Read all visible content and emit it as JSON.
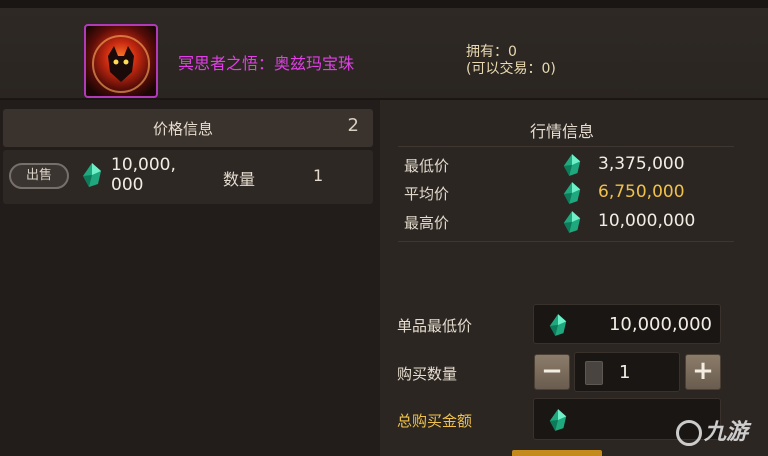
{
  "item": {
    "name": "冥思者之悟：奥兹玛宝珠",
    "owned_line": "拥有：0",
    "tradable_line": "(可以交易：0)",
    "icon": "demon-orb-icon"
  },
  "price_info": {
    "title": "价格信息",
    "count": "2",
    "listings": [
      {
        "badge": "出售",
        "price": "10,000,000",
        "qty_label": "数量",
        "qty": "1",
        "currency_icon": "gem-icon"
      }
    ]
  },
  "market": {
    "title": "行情信息",
    "rows": [
      {
        "label": "最低价",
        "value": "3,375,000"
      },
      {
        "label": "平均价",
        "value": "6,750,000"
      },
      {
        "label": "最高价",
        "value": "10,000,000"
      }
    ]
  },
  "purchase": {
    "unit_price_label": "单品最低价",
    "unit_price_value": "10,000,000",
    "quantity_label": "购买数量",
    "quantity_value": "1",
    "minus_label": "−",
    "plus_label": "+",
    "total_label": "总购买金额",
    "total_value": ""
  },
  "watermark": {
    "text": "九游"
  },
  "colors": {
    "item_name": "#e040e6",
    "avg_price": "#f0c14a",
    "total_label": "#f0c14a",
    "gem": "#2fd3a0"
  }
}
